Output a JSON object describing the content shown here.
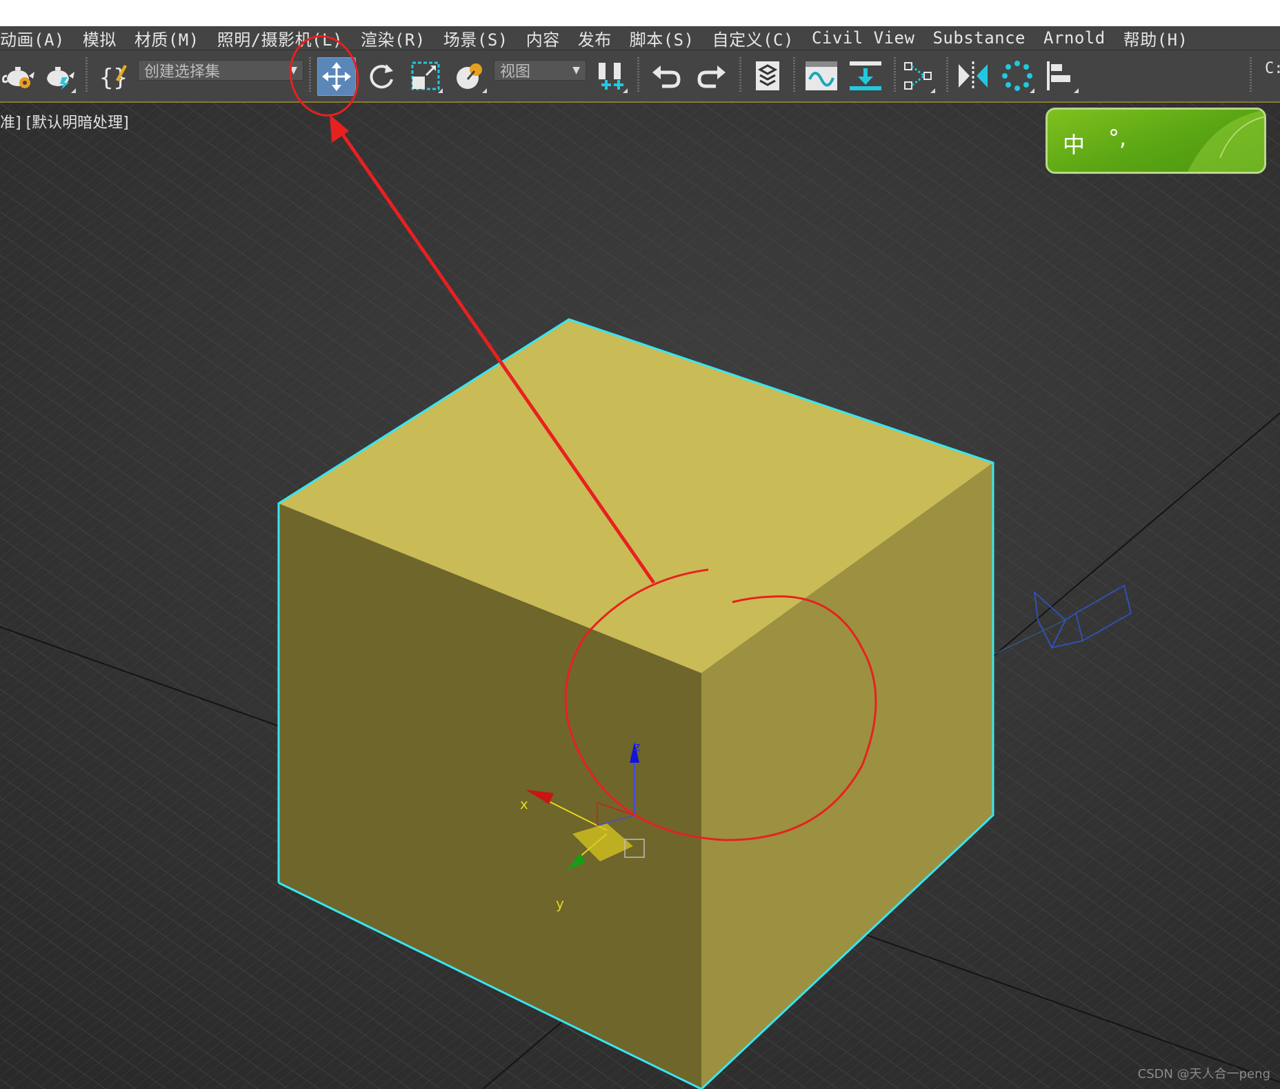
{
  "menubar": {
    "items": [
      "动画(A)",
      "模拟",
      "材质(M)",
      "照明/摄影机(L)",
      "渲染(R)",
      "场景(S)",
      "内容",
      "发布",
      "脚本(S)",
      "自定义(C)",
      "Civil View",
      "Substance",
      "Arnold",
      "帮助(H)"
    ]
  },
  "toolbar": {
    "selection_set_placeholder": "创建选择集",
    "view_dropdown_value": "视图",
    "right_edge_text": "C:"
  },
  "viewport": {
    "label": "准] [默认明暗处理]",
    "gizmo_axis_x": "x",
    "gizmo_axis_y": "y",
    "gizmo_axis_z": "z",
    "object_color": "#c9bb56",
    "selection_outline_color": "#38e6f2"
  },
  "ime": {
    "mode": "中",
    "punct": "°,"
  },
  "annotation_color": "#e82020",
  "watermark": "CSDN @天人合一peng"
}
